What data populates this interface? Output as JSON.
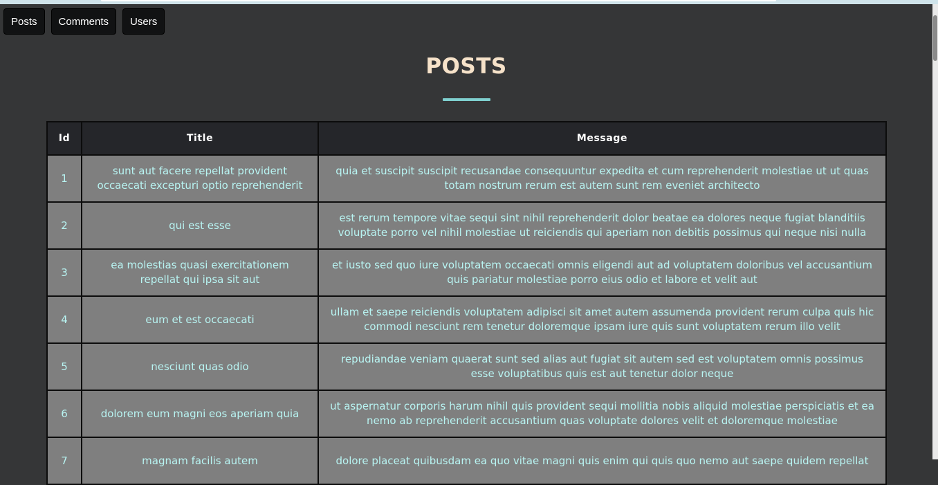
{
  "nav": {
    "items": [
      "Posts",
      "Comments",
      "Users"
    ]
  },
  "page": {
    "title": "POSTS"
  },
  "colors": {
    "background": "#353637",
    "title": "#f6e2c9",
    "accent": "#7fd0cf",
    "header_bg": "#25262a",
    "cell_bg": "#7f7f7f",
    "cell_text": "#b8f4f2"
  },
  "table": {
    "headers": [
      "Id",
      "Title",
      "Message"
    ],
    "rows": [
      {
        "id": "1",
        "title": "sunt aut facere repellat provident occaecati excepturi optio reprehenderit",
        "message": "quia et suscipit suscipit recusandae consequuntur expedita et cum reprehenderit molestiae ut ut quas totam nostrum rerum est autem sunt rem eveniet architecto"
      },
      {
        "id": "2",
        "title": "qui est esse",
        "message": "est rerum tempore vitae sequi sint nihil reprehenderit dolor beatae ea dolores neque fugiat blanditiis voluptate porro vel nihil molestiae ut reiciendis qui aperiam non debitis possimus qui neque nisi nulla"
      },
      {
        "id": "3",
        "title": "ea molestias quasi exercitationem repellat qui ipsa sit aut",
        "message": "et iusto sed quo iure voluptatem occaecati omnis eligendi aut ad voluptatem doloribus vel accusantium quis pariatur molestiae porro eius odio et labore et velit aut"
      },
      {
        "id": "4",
        "title": "eum et est occaecati",
        "message": "ullam et saepe reiciendis voluptatem adipisci sit amet autem assumenda provident rerum culpa quis hic commodi nesciunt rem tenetur doloremque ipsam iure quis sunt voluptatem rerum illo velit"
      },
      {
        "id": "5",
        "title": "nesciunt quas odio",
        "message": "repudiandae veniam quaerat sunt sed alias aut fugiat sit autem sed est voluptatem omnis possimus esse voluptatibus quis est aut tenetur dolor neque"
      },
      {
        "id": "6",
        "title": "dolorem eum magni eos aperiam quia",
        "message": "ut aspernatur corporis harum nihil quis provident sequi mollitia nobis aliquid molestiae perspiciatis et ea nemo ab reprehenderit accusantium quas voluptate dolores velit et doloremque molestiae"
      },
      {
        "id": "7",
        "title": "magnam facilis autem",
        "message": "dolore placeat quibusdam ea quo vitae magni quis enim qui quis quo nemo aut saepe quidem repellat"
      }
    ]
  }
}
